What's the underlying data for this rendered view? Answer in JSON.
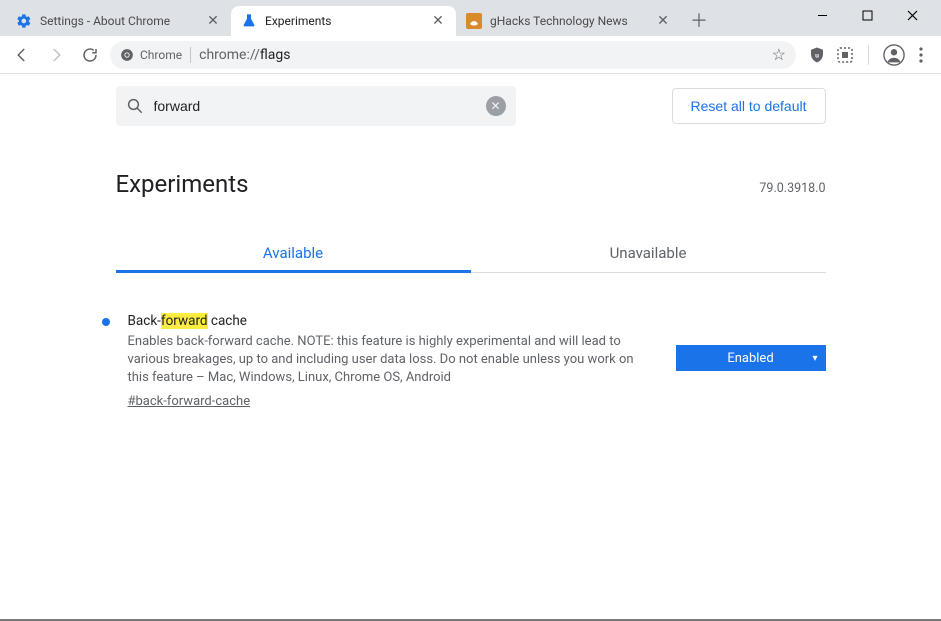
{
  "tabs": [
    {
      "title": "Settings - About Chrome",
      "active": false,
      "favicon": "gear"
    },
    {
      "title": "Experiments",
      "active": true,
      "favicon": "flask"
    },
    {
      "title": "gHacks Technology News",
      "active": false,
      "favicon": "ghacks"
    }
  ],
  "omnibox": {
    "identity": "Chrome",
    "url_display": "chrome://flags",
    "url_proto": "chrome://",
    "url_path": "flags"
  },
  "search": {
    "value": "forward"
  },
  "reset_label": "Reset all to default",
  "page_title": "Experiments",
  "version": "79.0.3918.0",
  "content_tabs": {
    "available": "Available",
    "unavailable": "Unavailable"
  },
  "experiment": {
    "title_pre": "Back-",
    "title_hl": "forward",
    "title_post": " cache",
    "description": "Enables back-forward cache. NOTE: this feature is highly experimental and will lead to various breakages, up to and including user data loss. Do not enable unless you work on this feature – Mac, Windows, Linux, Chrome OS, Android",
    "anchor": "#back-forward-cache",
    "state": "Enabled"
  }
}
